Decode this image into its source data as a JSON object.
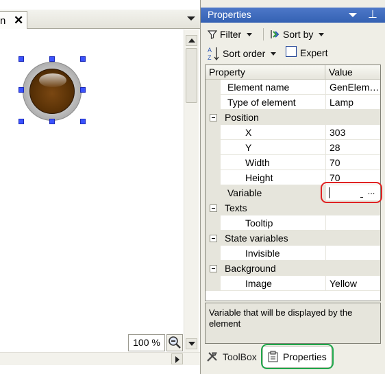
{
  "document_tab": {
    "label": "n",
    "close": "✕"
  },
  "editor": {
    "zoom": "100 %",
    "element": {
      "type": "lamp"
    }
  },
  "properties_panel": {
    "title": "Properties",
    "pin": "⊥",
    "toolbar": {
      "filter_label": "Filter",
      "sort_by_label": "Sort by",
      "sort_order_label": "Sort order",
      "expert_label": "Expert",
      "expert_checked": false
    },
    "grid": {
      "header_property": "Property",
      "header_value": "Value",
      "rows": [
        {
          "name": "Element name",
          "value": "GenElem…"
        },
        {
          "name": "Type of element",
          "value": "Lamp"
        },
        {
          "name": "Position",
          "category": true
        },
        {
          "name": "X",
          "value": "303"
        },
        {
          "name": "Y",
          "value": "28"
        },
        {
          "name": "Width",
          "value": "70"
        },
        {
          "name": "Height",
          "value": "70"
        },
        {
          "name": "Variable",
          "value": "",
          "editor_button": "...",
          "selected": true
        },
        {
          "name": "Texts",
          "category": true
        },
        {
          "name": "Tooltip",
          "value": ""
        },
        {
          "name": "State variables",
          "category": true
        },
        {
          "name": "Invisible",
          "value": ""
        },
        {
          "name": "Background",
          "category": true
        },
        {
          "name": "Image",
          "value": "Yellow"
        }
      ]
    },
    "description": "Variable that will be displayed by the element",
    "bottom_tabs": {
      "toolbox_label": "ToolBox",
      "properties_label": "Properties"
    }
  },
  "colors": {
    "panel_header": "#3d6bbd",
    "highlight_red": "#e02323",
    "highlight_green": "#1fa74b",
    "selection_handle": "#3a52ff",
    "lamp": "#5a3206"
  }
}
